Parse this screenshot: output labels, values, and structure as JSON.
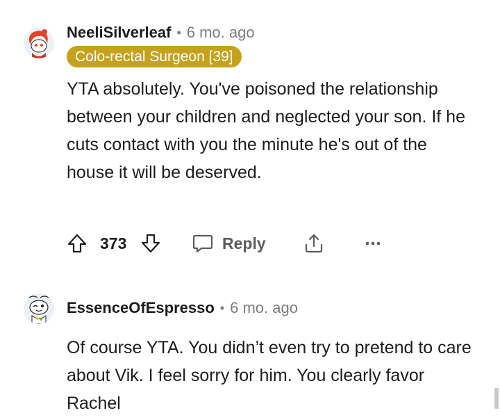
{
  "comments": [
    {
      "username": "NeeliSilverleaf",
      "separator": "•",
      "time": "6 mo. ago",
      "flair": "Colo-rectal Surgeon [39]",
      "body": "YTA absolutely. You've poisoned the relationship between your children and neglected your son. If he cuts contact with you the minute he's out of the house it will be deserved.",
      "score": "373",
      "reply_label": "Reply",
      "avatar_icon": "snoo-avatar-red-hair"
    },
    {
      "username": "EssenceOfEspresso",
      "separator": "•",
      "time": "6 mo. ago",
      "body": "Of course YTA. You didn’t even try to pretend to care about Vik. I feel sorry for him. You clearly favor Rachel",
      "avatar_icon": "snoo-avatar-winking"
    }
  ],
  "icons": {
    "upvote": "upvote-arrow-icon",
    "downvote": "downvote-arrow-icon",
    "reply": "reply-bubble-icon",
    "share": "share-icon",
    "more": "more-options-icon"
  },
  "colors": {
    "flair_bg": "#c4a21c",
    "muted": "#7c7c7c",
    "text": "#1c1c1c"
  }
}
